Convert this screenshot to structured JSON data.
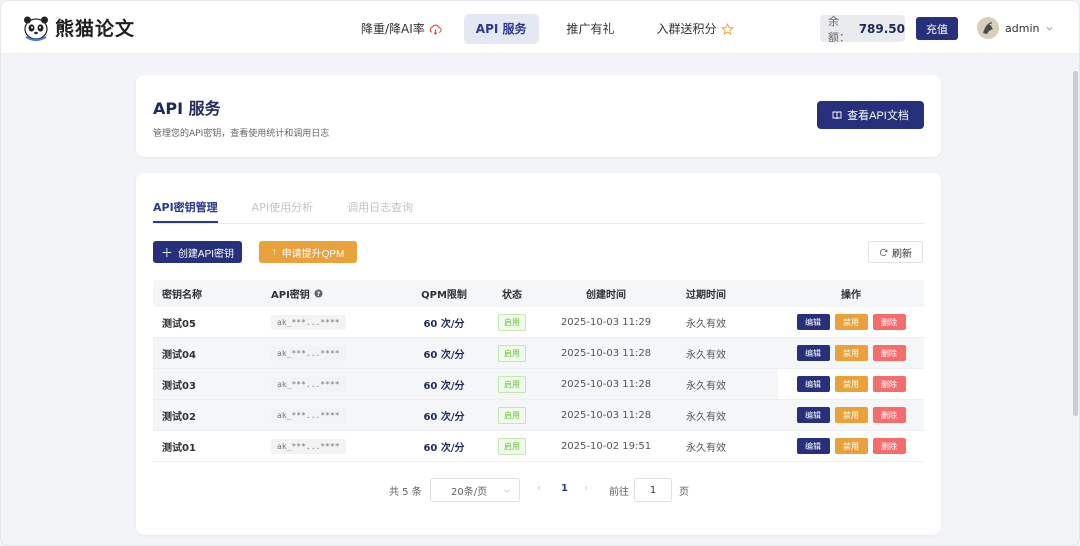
{
  "header": {
    "logo_text": "熊猫论文",
    "nav": [
      {
        "label": "降重/降AI率",
        "icon": "cloud-icon"
      },
      {
        "label": "API 服务"
      },
      {
        "label": "推广有礼"
      },
      {
        "label": "入群送积分",
        "icon": "star-icon"
      }
    ],
    "balance_label": "余额：",
    "balance_amount": "789.50",
    "recharge_label": "充值",
    "username": "admin"
  },
  "title_card": {
    "title": "API 服务",
    "subtitle": "管理您的API密钥，查看使用统计和调用日志",
    "doc_button": "查看API文档"
  },
  "tabs": [
    "API密钥管理",
    "API使用分析",
    "调用日志查询"
  ],
  "actions": {
    "create": "创建API密钥",
    "qpm": "申请提升QPM",
    "refresh": "刷新"
  },
  "table": {
    "headers": {
      "name": "密钥名称",
      "key": "API密钥",
      "qpm": "QPM限制",
      "status": "状态",
      "created": "创建时间",
      "expire": "过期时间",
      "ops": "操作"
    },
    "rows": [
      {
        "name": "测试05",
        "key": "ak_***...****",
        "qpm": "60 次/分",
        "status": "启用",
        "created": "2025-10-03 11:29",
        "expire": "永久有效"
      },
      {
        "name": "测试04",
        "key": "ak_***...****",
        "qpm": "60 次/分",
        "status": "启用",
        "created": "2025-10-03 11:28",
        "expire": "永久有效"
      },
      {
        "name": "测试03",
        "key": "ak_***...****",
        "qpm": "60 次/分",
        "status": "启用",
        "created": "2025-10-03 11:28",
        "expire": "永久有效"
      },
      {
        "name": "测试02",
        "key": "ak_***...****",
        "qpm": "60 次/分",
        "status": "启用",
        "created": "2025-10-03 11:28",
        "expire": "永久有效"
      },
      {
        "name": "测试01",
        "key": "ak_***...****",
        "qpm": "60 次/分",
        "status": "启用",
        "created": "2025-10-02 19:51",
        "expire": "永久有效"
      }
    ],
    "op_labels": {
      "edit": "编辑",
      "disable": "禁用",
      "delete": "删除"
    }
  },
  "pagination": {
    "total": "共 5 条",
    "page_size": "20条/页",
    "current_page": "1",
    "goto_label": "前往",
    "goto_value": "1",
    "page_suffix": "页"
  },
  "colors": {
    "primary": "#27307a",
    "warning": "#e9a13b",
    "danger": "#f56c6c",
    "success": "#67c23a"
  }
}
